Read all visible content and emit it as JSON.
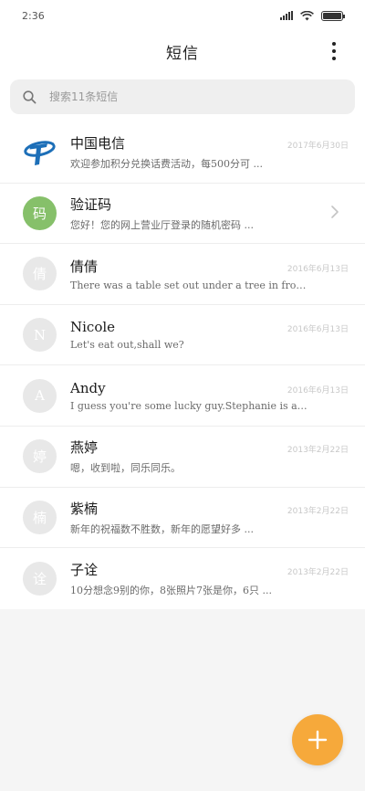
{
  "status_bar": {
    "time": "2:36"
  },
  "header": {
    "title": "短信",
    "more_icon": "more-vertical-icon"
  },
  "search": {
    "placeholder": "搜索11条短信",
    "value": "",
    "icon": "search-icon"
  },
  "conversations": [
    {
      "name": "中国电信",
      "date": "2017年6月30日",
      "snippet": "欢迎参加积分兑换话费活动，每500分可 ...",
      "avatar_type": "logo",
      "avatar_color": "#1d6fb8"
    },
    {
      "name": "验证码",
      "date": "",
      "snippet": "您好！您的网上营业厅登录的随机密码 ...",
      "avatar_text": "码",
      "avatar_color": "#86c06a",
      "has_chevron": true
    },
    {
      "name": "倩倩",
      "date": "2016年6月13日",
      "snippet": "There was a table set out under a tree in front of the hous",
      "avatar_text": "倩",
      "avatar_color": "#e8e8e8"
    },
    {
      "name": "Nicole",
      "date": "2016年6月13日",
      "snippet": "Let's eat out,shall we?",
      "avatar_text": "N",
      "avatar_color": "#e8e8e8"
    },
    {
      "name": "Andy",
      "date": "2016年6月13日",
      "snippet": "I guess you're some lucky guy.Stephanie is a nice girl.",
      "avatar_text": "A",
      "avatar_color": "#e8e8e8"
    },
    {
      "name": "燕婷",
      "date": "2013年2月22日",
      "snippet": "嗯，收到啦，同乐同乐。",
      "avatar_text": "婷",
      "avatar_color": "#e8e8e8"
    },
    {
      "name": "紫楠",
      "date": "2013年2月22日",
      "snippet": "新年的祝福数不胜数，新年的愿望好多 ...",
      "avatar_text": "楠",
      "avatar_color": "#e8e8e8"
    },
    {
      "name": "子诠",
      "date": "2013年2月22日",
      "snippet": "10分想念9别的你，8张照片7张是你，6只 ...",
      "avatar_text": "诠",
      "avatar_color": "#e8e8e8"
    }
  ],
  "fab": {
    "icon": "plus-icon",
    "color": "#f6a93b"
  }
}
